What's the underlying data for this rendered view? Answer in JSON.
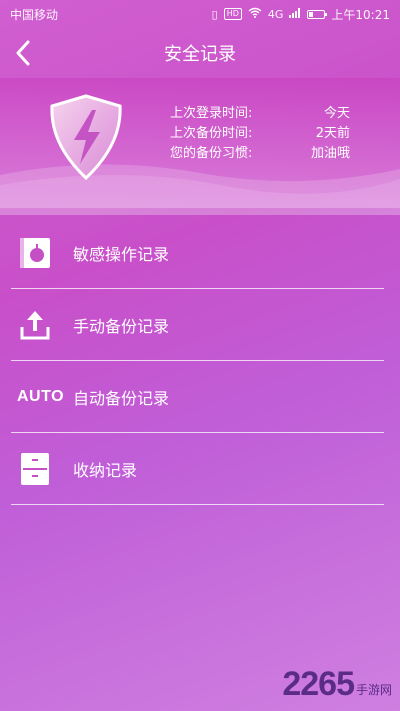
{
  "status_bar": {
    "carrier": "中国移动",
    "network": "4G",
    "hd": "HD",
    "time": "上午10:21"
  },
  "header": {
    "title": "安全记录"
  },
  "info": [
    {
      "label": "上次登录时间:",
      "value": "今天"
    },
    {
      "label": "上次备份时间:",
      "value": "2天前"
    },
    {
      "label": "您的备份习惯:",
      "value": "加油哦"
    }
  ],
  "menu": [
    {
      "label": "敏感操作记录",
      "icon": "sensitive-record-icon"
    },
    {
      "label": "手动备份记录",
      "icon": "upload-icon"
    },
    {
      "label": "自动备份记录",
      "icon": "auto-icon",
      "icon_text": "AUTO"
    },
    {
      "label": "收纳记录",
      "icon": "drawer-icon"
    }
  ],
  "watermark": {
    "number": "2265",
    "text": "手游网"
  },
  "colors": {
    "background": "#c84fc9",
    "watermark": "#5a2c86"
  }
}
